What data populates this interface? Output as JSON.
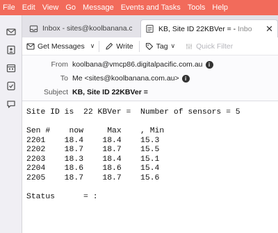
{
  "menu": [
    "File",
    "Edit",
    "View",
    "Go",
    "Message",
    "Events and Tasks",
    "Tools",
    "Help"
  ],
  "spaces": [
    "mail-icon",
    "address-book-icon",
    "calendar-icon",
    "tasks-icon",
    "chat-icon"
  ],
  "tabs": [
    {
      "label": "Inbox - sites@koolbanana.com",
      "icon": "inbox-icon",
      "active": false
    },
    {
      "label": "KB, Site ID 22KBVer = - ",
      "suffix": "Inbo",
      "icon": "message-icon",
      "active": true
    }
  ],
  "toolbar": {
    "get_messages": "Get Messages",
    "write": "Write",
    "tag": "Tag",
    "quick_filter": "Quick Filter"
  },
  "header": {
    "from_label": "From",
    "from_value": "koolbana@vmcp86.digitalpacific.com.au",
    "to_label": "To",
    "to_value": "Me <sites@koolbanana.com.au>",
    "subject_label": "Subject",
    "subject_value": "KB, Site ID 22KBVer ="
  },
  "body": {
    "line1": "Site ID is  22 KBVer =  Number of sensors = 5",
    "table_header": "Sen #    now     Max    , Min",
    "rows": [
      "2201    18.4    18.4    15.3",
      "2202    18.7    18.7    15.5",
      "2203    18.3    18.4    15.1",
      "2204    18.6    18.6    15.4",
      "2205    18.7    18.7    15.6"
    ],
    "status": "Status      = :"
  },
  "colors": {
    "menubar": "#f26b5b",
    "tabbar": "#e3e2e8",
    "spaces": "#f0eff4"
  }
}
